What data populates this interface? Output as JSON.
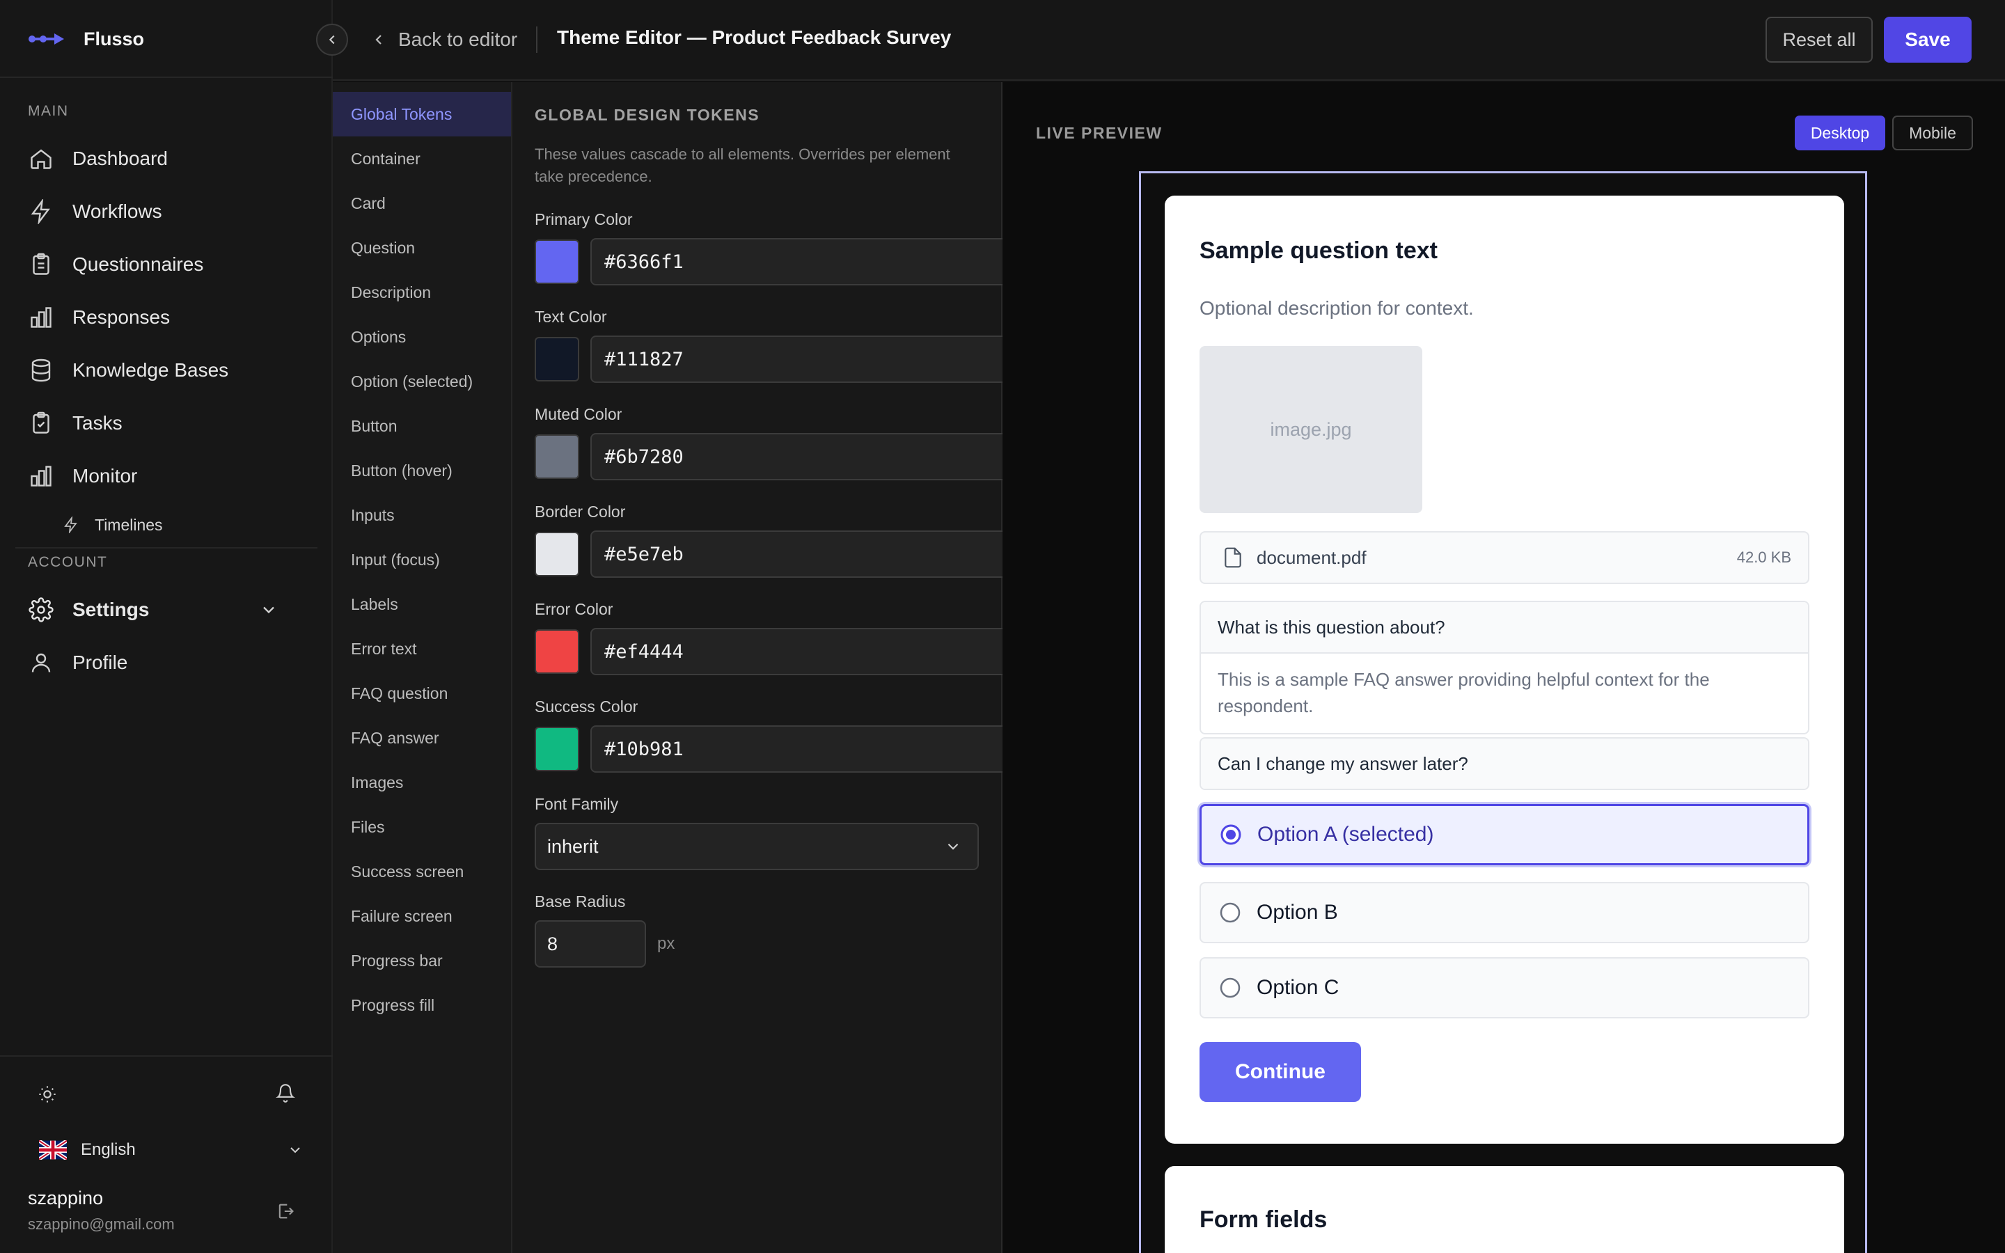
{
  "app": {
    "name": "Flusso"
  },
  "sidebar": {
    "main_label": "MAIN",
    "items": [
      {
        "label": "Dashboard",
        "icon": "home-icon"
      },
      {
        "label": "Workflows",
        "icon": "bolt-icon"
      },
      {
        "label": "Questionnaires",
        "icon": "clipboard-icon"
      },
      {
        "label": "Responses",
        "icon": "bar-chart-icon"
      },
      {
        "label": "Knowledge Bases",
        "icon": "database-icon"
      },
      {
        "label": "Tasks",
        "icon": "clipboard-check-icon"
      },
      {
        "label": "Monitor",
        "icon": "bar-chart-icon"
      }
    ],
    "sub_items": [
      {
        "label": "Timelines",
        "icon": "bolt-icon"
      }
    ],
    "account_label": "ACCOUNT",
    "account_items": [
      {
        "label": "Settings",
        "icon": "gear-icon"
      },
      {
        "label": "Profile",
        "icon": "user-icon"
      }
    ],
    "language": "English",
    "user": {
      "name": "szappino",
      "email": "szappino@gmail.com"
    }
  },
  "topbar": {
    "back_label": "Back to editor",
    "title": "Theme Editor — Product Feedback Survey",
    "reset_label": "Reset all",
    "save_label": "Save"
  },
  "elements": [
    "Global Tokens",
    "Container",
    "Card",
    "Question",
    "Description",
    "Options",
    "Option (selected)",
    "Button",
    "Button (hover)",
    "Inputs",
    "Input (focus)",
    "Labels",
    "Error text",
    "FAQ question",
    "FAQ answer",
    "Images",
    "Files",
    "Success screen",
    "Failure screen",
    "Progress bar",
    "Progress fill"
  ],
  "active_element": "Global Tokens",
  "tokens": {
    "title": "GLOBAL DESIGN TOKENS",
    "description": "These values cascade to all elements. Overrides per element take precedence.",
    "colors": [
      {
        "label": "Primary Color",
        "value": "#6366f1"
      },
      {
        "label": "Text Color",
        "value": "#111827"
      },
      {
        "label": "Muted Color",
        "value": "#6b7280"
      },
      {
        "label": "Border Color",
        "value": "#e5e7eb"
      },
      {
        "label": "Error Color",
        "value": "#ef4444"
      },
      {
        "label": "Success Color",
        "value": "#10b981"
      }
    ],
    "font_family_label": "Font Family",
    "font_family_value": "inherit",
    "base_radius_label": "Base Radius",
    "base_radius_value": "8",
    "base_radius_unit": "px"
  },
  "preview": {
    "label": "LIVE PREVIEW",
    "device_desktop": "Desktop",
    "device_mobile": "Mobile",
    "question_title": "Sample question text",
    "question_description": "Optional description for context.",
    "image_placeholder": "image.jpg",
    "file": {
      "name": "document.pdf",
      "size": "42.0 KB"
    },
    "faq": [
      {
        "question": "What is this question about?",
        "answer": "This is a sample FAQ answer providing helpful context for the respondent."
      },
      {
        "question": "Can I change my answer later?"
      }
    ],
    "options": [
      {
        "label": "Option A (selected)",
        "selected": true
      },
      {
        "label": "Option B",
        "selected": false
      },
      {
        "label": "Option C",
        "selected": false
      }
    ],
    "continue_label": "Continue",
    "next_card_title": "Form fields"
  },
  "colors": {
    "accent": "#4f46e5",
    "brand": "#6366f1"
  }
}
